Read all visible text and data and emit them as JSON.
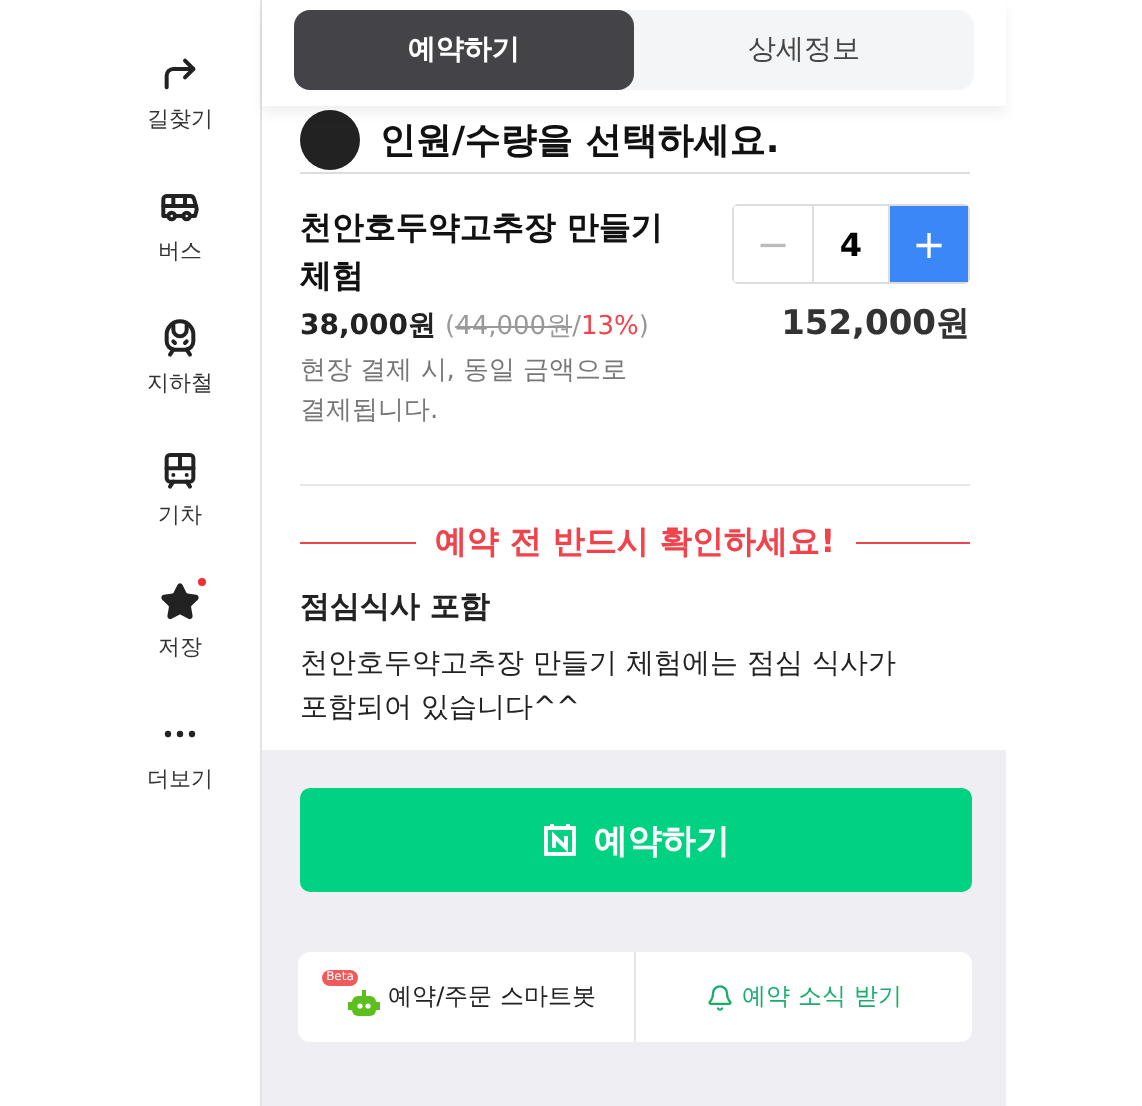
{
  "sidebar": {
    "items": [
      {
        "kind": "directions",
        "label": "길찾기",
        "badge": false
      },
      {
        "kind": "bus",
        "label": "버스",
        "badge": false
      },
      {
        "kind": "subway",
        "label": "지하철",
        "badge": false
      },
      {
        "kind": "train",
        "label": "기차",
        "badge": false
      },
      {
        "kind": "star",
        "label": "저장",
        "badge": true
      },
      {
        "kind": "more",
        "label": "더보기",
        "badge": false
      }
    ]
  },
  "tabs": [
    {
      "label": "예약하기",
      "selected": true
    },
    {
      "label": "상세정보",
      "selected": false
    }
  ],
  "section_title": "인원/수량을 선택하세요.",
  "product": {
    "name": "천안호두약고추장 만들기 체험",
    "price": "38,000원",
    "open": "(",
    "original_price": "44,000원",
    "sep": "/",
    "discount": "13%",
    "close": ")",
    "note": "현장 결제 시, 동일 금액으로 결제됩니다.",
    "quantity": "4",
    "minus": "−",
    "plus": "+",
    "total": "152,000원"
  },
  "notice": {
    "title": "예약 전 반드시 확인하세요!",
    "heading": "점심식사 포함",
    "body": "천안호두약고추장 만들기 체험에는 점심 식사가 포함되어 있습니다^^"
  },
  "book_button": "예약하기",
  "footer": {
    "bot_badge": "Beta",
    "bot_label": "예약/주문 스마트봇",
    "alert_label": "예약 소식 받기"
  }
}
